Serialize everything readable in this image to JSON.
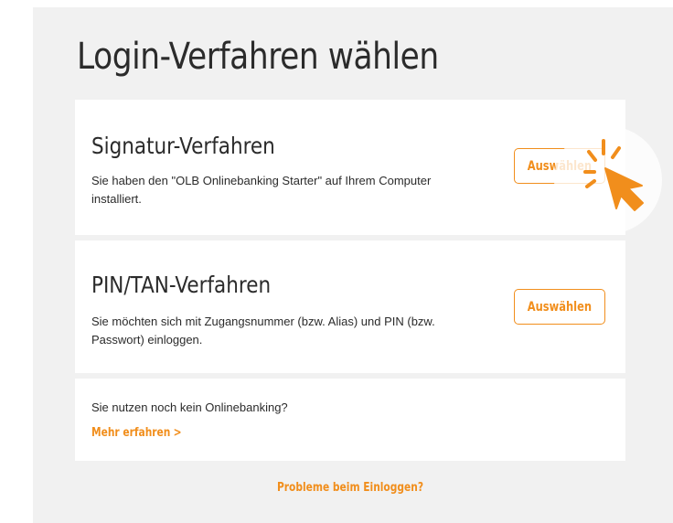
{
  "page": {
    "title": "Login-Verfahren wählen"
  },
  "options": [
    {
      "heading": "Signatur-Verfahren",
      "description": "Sie haben den \"OLB Onlinebanking Starter\" auf Ihrem Computer installiert.",
      "button_label": "Auswählen"
    },
    {
      "heading": "PIN/TAN-Verfahren",
      "description": "Sie möchten sich mit Zugangsnummer (bzw. Alias) und PIN (bzw. Passwort) einloggen.",
      "button_label": "Auswählen"
    }
  ],
  "info": {
    "text": "Sie nutzen noch kein Onlinebanking?",
    "link_label": "Mehr erfahren",
    "link_icon": "chevron-right-icon"
  },
  "footer": {
    "problems_link": "Probleme beim Einloggen?"
  },
  "colors": {
    "accent": "#f18e1c",
    "text": "#2b2b2b",
    "panel_background": "#f1f1f1",
    "card_background": "#ffffff"
  },
  "cursor": {
    "icon": "click-cursor-icon"
  }
}
